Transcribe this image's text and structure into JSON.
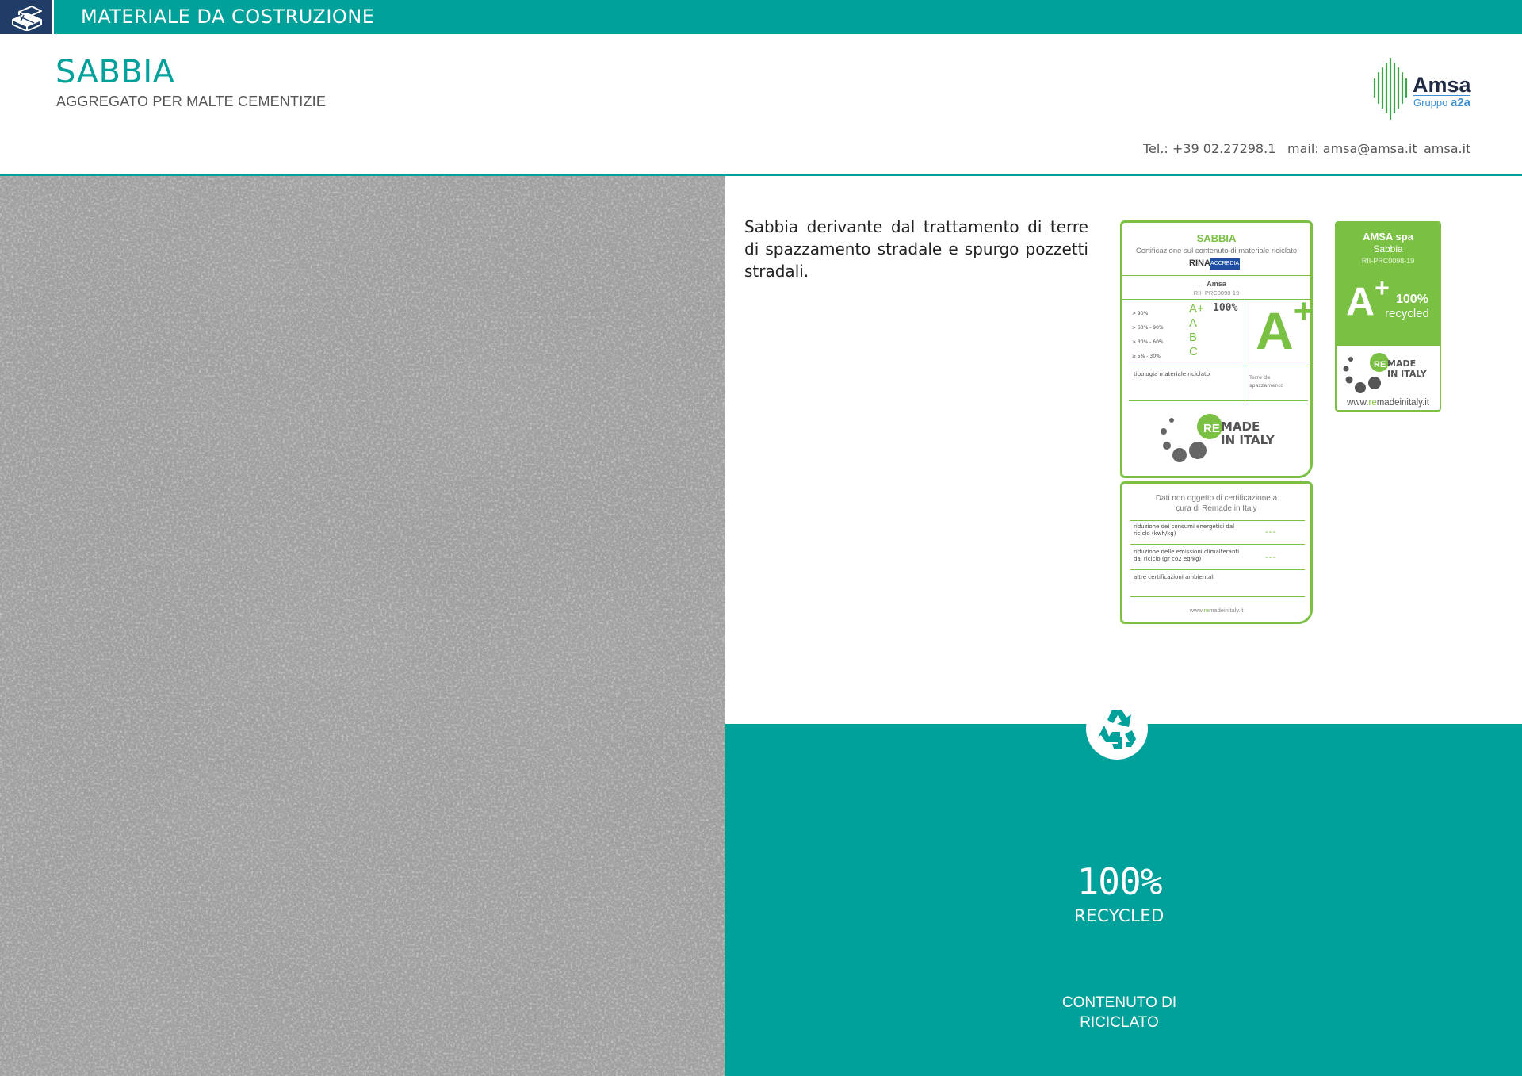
{
  "header": {
    "category": "MATERIALE DA COSTRUZIONE",
    "title": "SABBIA",
    "subtitle": "AGGREGATO PER MALTE CEMENTIZIE",
    "icon": "bricks-icon"
  },
  "logo": {
    "brand": "Amsa",
    "group_prefix": "Gruppo ",
    "group_name": "a2a"
  },
  "contact": {
    "tel": "Tel.:  +39 02.27298.1",
    "mail": "mail: amsa@amsa.it",
    "web": "amsa.it"
  },
  "description": "Sabbia derivante dal trattamento di terre di spazzamento stradale e spurgo pozzetti stradali.",
  "certificate": {
    "title": "SABBIA",
    "description": "Certificazione sul contenuto di materiale riciclato",
    "org_a": "RINA",
    "org_b": "ACCREDIA",
    "company": "Amsa",
    "code": "RII- PRC0098-19",
    "rows": [
      {
        "range": "> 90%",
        "grade": "A+"
      },
      {
        "range": "> 60% - 90%",
        "grade": "A"
      },
      {
        "range": "> 30% - 60%",
        "grade": "B"
      },
      {
        "range": "≥  5% - 30%",
        "grade": "C"
      }
    ],
    "percent": "100%",
    "big_grade": "A",
    "big_grade_sup": "+",
    "material_type_label": "tipologia materiale riciclato",
    "material_type_value": "Terre da spazzamento",
    "remade_line1": "MADE",
    "remade_line2": "IN ITALY",
    "remade_re": "RE"
  },
  "certificate_data": {
    "heading": "Dati non oggetto di certificazione a cura di Remade in Italy",
    "rows": [
      {
        "label": "riduzione dei consumi energetici dal riciclo (kwh/kg)",
        "value": "---"
      },
      {
        "label": "riduzione delle emissioni climalteranti dal riciclo (gr co2 eq/kg)",
        "value": "---"
      },
      {
        "label": "altre certificazioni ambientali",
        "value": ""
      }
    ],
    "web_prefix": "www.",
    "web_re": "re",
    "web_suffix": "madeinitaly.it"
  },
  "certificate_small": {
    "company": "AMSA spa",
    "product": "Sabbia",
    "code": "RII-PRC0098-19",
    "grade": "A",
    "grade_sup": "+",
    "percent": "100%",
    "recycled": "recycled",
    "web_prefix": "www.",
    "web_re": "re",
    "web_suffix": "madeinitaly.it"
  },
  "recycled_panel": {
    "percent": "100%",
    "label": "RECYCLED",
    "content_label": "CONTENUTO DI RICICLATO",
    "icon": "recycle-icon"
  },
  "colors": {
    "teal": "#00a19b",
    "navy": "#1f3d66",
    "green": "#7ac143"
  }
}
